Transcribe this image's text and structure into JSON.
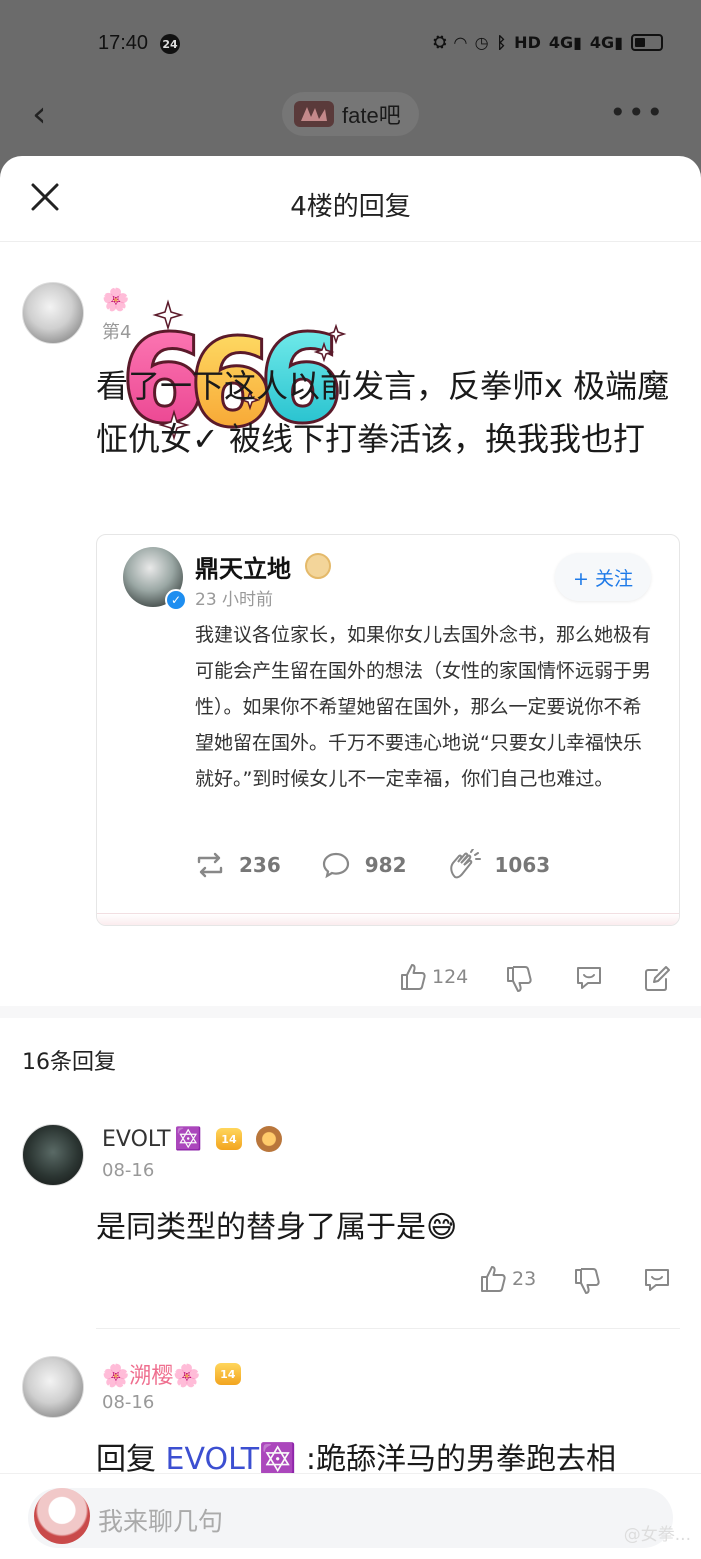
{
  "status_bar": {
    "time": "17:40",
    "notification_badge": "24",
    "signal_labels": [
      "HD",
      "4G",
      "4G"
    ]
  },
  "app_bar": {
    "forum_name": "fate吧",
    "more_label": "•••"
  },
  "sheet": {
    "title": "4楼的回复"
  },
  "main_post": {
    "author": "🌸",
    "floor_info": "第4",
    "sticker_text": "666",
    "text": "看了一下这人以前发言，反拳师x 极端魔怔仇女✓ 被线下打拳活该，换我我也打",
    "quote": {
      "name": "鼎天立地",
      "time": "23 小时前",
      "follow_label": "+ 关注",
      "body": "我建议各位家长，如果你女儿去国外念书，那么她极有可能会产生留在国外的想法（女性的家国情怀远弱于男性）。如果你不希望她留在国外，那么一定要说你不希望她留在国外。千万不要违心地说“只要女儿幸福快乐就好。”到时候女儿不一定幸福，你们自己也难过。",
      "reposts": "236",
      "comments": "982",
      "likes": "1063"
    },
    "like_count": "124"
  },
  "replies_header": "16条回复",
  "replies": [
    {
      "name": "EVOLT",
      "name_emoji": "🔯",
      "level": "14",
      "date": "08-16",
      "text": "是同类型的替身了属于是😅",
      "likes": "23"
    },
    {
      "name": "🌸溯樱🌸",
      "level": "14",
      "date": "08-16",
      "reply_prefix": "回复 ",
      "reply_to": "EVOLT🔯",
      "text": " :跪舔洋马的男拳跑去相"
    }
  ],
  "input_bar": {
    "placeholder": "我来聊几句",
    "watermark": "@女拳..."
  },
  "colors": {
    "accent_blue": "#1e7ae8",
    "link_blue": "#3c4fd1",
    "sheet_bg": "#ffffff",
    "dim_bg": "#6b6b6b"
  }
}
